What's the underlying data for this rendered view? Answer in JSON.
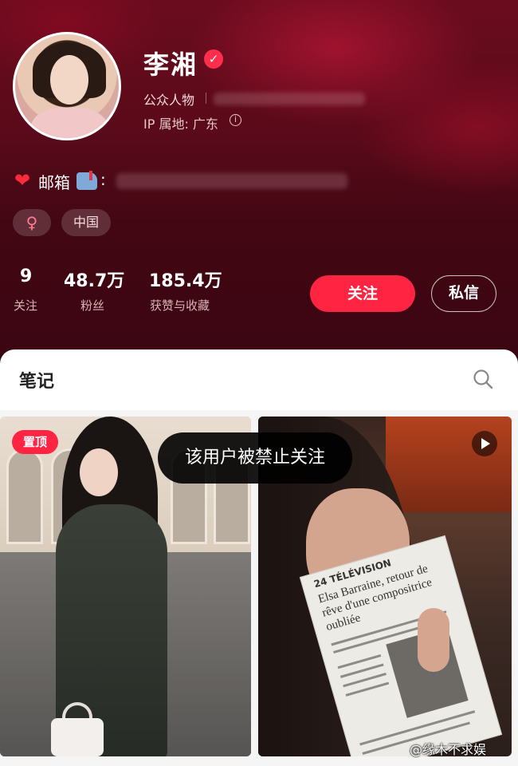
{
  "profile": {
    "name": "李湘",
    "role": "公众人物",
    "ip_location": "IP 属地: 广东",
    "email_label": "邮箱",
    "email_colon": ":",
    "tags": [
      "♀",
      "中国"
    ]
  },
  "stats": [
    {
      "value": "9",
      "label": "关注"
    },
    {
      "value": "48.7万",
      "label": "粉丝"
    },
    {
      "value": "185.4万",
      "label": "获赞与收藏"
    }
  ],
  "actions": {
    "follow": "关注",
    "message": "私信"
  },
  "tabs": {
    "notes": "笔记"
  },
  "feed": {
    "pinned_badge": "置顶",
    "newspaper_page": "24 TÉLÉVISION",
    "newspaper_headline": "Elsa Barraine, retour de rêve d'une compositrice oubliée"
  },
  "toast": "该用户被禁止关注",
  "watermark": "@缘木不求娱",
  "colors": {
    "accent": "#ff2442",
    "header_bg": "#4a0815"
  }
}
